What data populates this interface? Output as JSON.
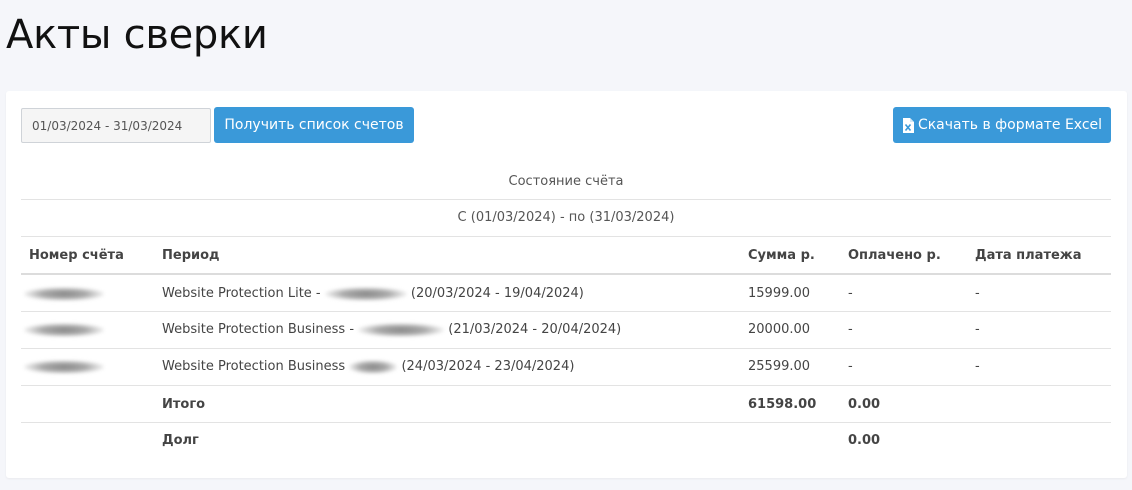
{
  "page": {
    "title": "Акты сверки"
  },
  "filters": {
    "date_range": "01/03/2024 - 31/03/2024",
    "get_button": "Получить список счетов",
    "excel_button": "Скачать в формате Excel"
  },
  "status": {
    "title": "Состояние счёта",
    "period": "С (01/03/2024) - по (31/03/2024)"
  },
  "table": {
    "headers": {
      "number": "Номер счёта",
      "period": "Период",
      "sum": "Сумма р.",
      "paid": "Оплачено р.",
      "date": "Дата платежа"
    },
    "rows": [
      {
        "service": "Website Protection Lite -",
        "range": "(20/03/2024 - 19/04/2024)",
        "sum": "15999.00",
        "paid": "-",
        "date": "-"
      },
      {
        "service": "Website Protection Business -",
        "range": "(21/03/2024 - 20/04/2024)",
        "sum": "20000.00",
        "paid": "-",
        "date": "-"
      },
      {
        "service": "Website Protection Business",
        "range": "(24/03/2024 - 23/04/2024)",
        "sum": "25599.00",
        "paid": "-",
        "date": "-"
      }
    ],
    "total": {
      "label": "Итого",
      "sum": "61598.00",
      "paid": "0.00"
    },
    "debt": {
      "label": "Долг",
      "paid": "0.00"
    }
  },
  "colors": {
    "accent": "#3a99d9",
    "background": "#f5f6fa"
  },
  "icons": {
    "excel": "excel-file-icon"
  }
}
